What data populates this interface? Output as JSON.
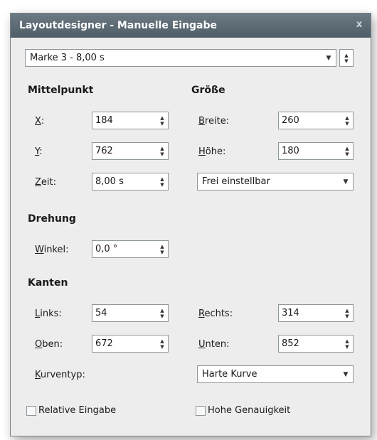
{
  "window": {
    "title": "Layoutdesigner - Manuelle Eingabe",
    "close": "x"
  },
  "marker_select": {
    "value": "Marke 3 - 8,00 s"
  },
  "mittelpunkt": {
    "heading": "Mittelpunkt",
    "x_label_u": "X",
    "x_label_rest": ":",
    "x_value": "184",
    "y_label_u": "Y",
    "y_label_rest": ":",
    "y_value": "762",
    "zeit_label_u": "Z",
    "zeit_label_rest": "eit:",
    "zeit_value": "8,00 s"
  },
  "groesse": {
    "heading": "Größe",
    "breite_label_u": "B",
    "breite_label_rest": "reite:",
    "breite_value": "260",
    "hoehe_label_u": "H",
    "hoehe_label_rest": "öhe:",
    "hoehe_value": "180",
    "mode_value": "Frei einstellbar"
  },
  "drehung": {
    "heading": "Drehung",
    "winkel_label_u": "W",
    "winkel_label_rest": "inkel:",
    "winkel_value": "0,0 °"
  },
  "kanten": {
    "heading": "Kanten",
    "links_label_u": "L",
    "links_label_rest": "inks:",
    "links_value": "54",
    "oben_label_u": "O",
    "oben_label_rest": "ben:",
    "oben_value": "672",
    "rechts_label_u": "R",
    "rechts_label_rest": "echts:",
    "rechts_value": "314",
    "unten_label_u": "U",
    "unten_label_rest": "nten:",
    "unten_value": "852",
    "kurventyp_label_u": "K",
    "kurventyp_label_rest": "urventyp:",
    "kurventyp_value": "Harte Kurve"
  },
  "options": {
    "relative_label": "Relative Eingabe",
    "relative_checked": false,
    "hohe_label": "Hohe Genauigkeit",
    "hohe_checked": false
  }
}
